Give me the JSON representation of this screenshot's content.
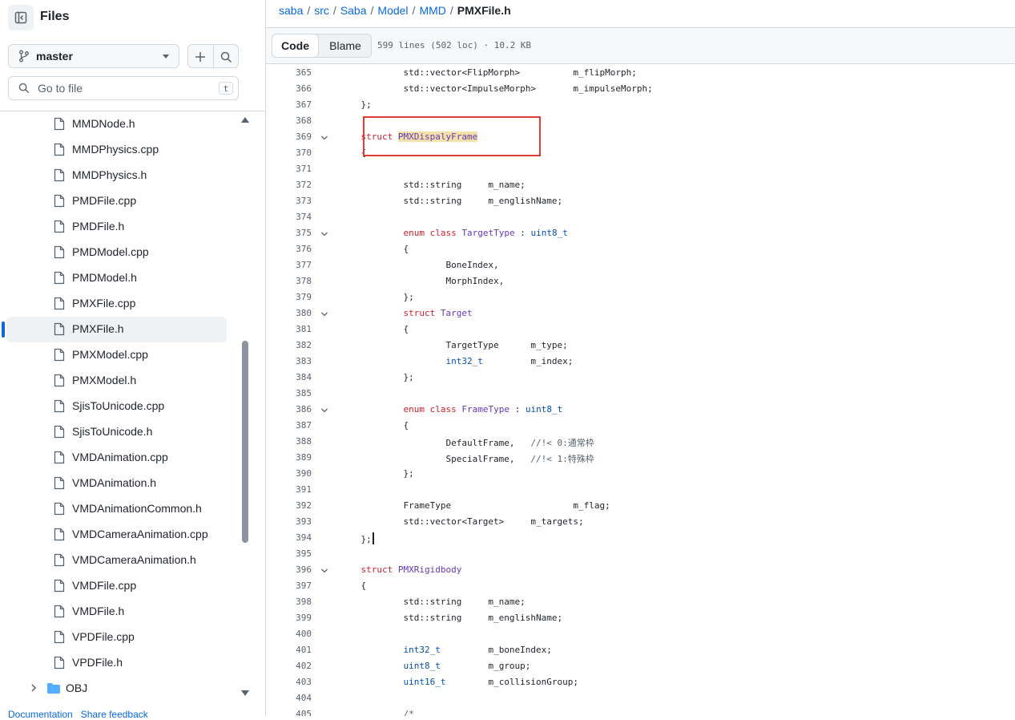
{
  "sidebar": {
    "title": "Files",
    "branch": "master",
    "goto_placeholder": "Go to file",
    "goto_shortcut": "t",
    "files": [
      "MMDNode.h",
      "MMDPhysics.cpp",
      "MMDPhysics.h",
      "PMDFile.cpp",
      "PMDFile.h",
      "PMDModel.cpp",
      "PMDModel.h",
      "PMXFile.cpp",
      "PMXFile.h",
      "PMXModel.cpp",
      "PMXModel.h",
      "SjisToUnicode.cpp",
      "SjisToUnicode.h",
      "VMDAnimation.cpp",
      "VMDAnimation.h",
      "VMDAnimationCommon.h",
      "VMDCameraAnimation.cpp",
      "VMDCameraAnimation.h",
      "VMDFile.cpp",
      "VMDFile.h",
      "VPDFile.cpp",
      "VPDFile.h"
    ],
    "selected_file": "PMXFile.h",
    "folder": "OBJ",
    "footer": [
      "Documentation",
      "Share feedback"
    ]
  },
  "breadcrumb": [
    "saba",
    "src",
    "Saba",
    "Model",
    "MMD"
  ],
  "current_file": "PMXFile.h",
  "toolbar": {
    "code_label": "Code",
    "blame_label": "Blame",
    "file_info": "599 lines (502 loc) · 10.2 KB"
  },
  "code_lines": [
    {
      "n": "365",
      "fold": false,
      "parts": [
        [
          "",
          "            std::vector<FlipMorph>          m_flipMorph;"
        ]
      ]
    },
    {
      "n": "366",
      "fold": false,
      "parts": [
        [
          "",
          "            std::vector<ImpulseMorph>       m_impulseMorph;"
        ]
      ]
    },
    {
      "n": "367",
      "fold": false,
      "parts": [
        [
          "",
          "    };"
        ]
      ]
    },
    {
      "n": "368",
      "fold": false,
      "parts": []
    },
    {
      "n": "369",
      "fold": true,
      "parts": [
        [
          "",
          "    "
        ],
        [
          "kw",
          "struct"
        ],
        [
          "",
          ""
        ],
        [
          "",
          ""
        ],
        [
          "hl ty",
          "PMXDispalyFrame"
        ]
      ],
      "space_after_kw": true
    },
    {
      "n": "370",
      "fold": false,
      "parts": [
        [
          "",
          "    {"
        ]
      ]
    },
    {
      "n": "371",
      "fold": false,
      "parts": []
    },
    {
      "n": "372",
      "fold": false,
      "parts": [
        [
          "",
          "            std::string     m_name;"
        ]
      ]
    },
    {
      "n": "373",
      "fold": false,
      "parts": [
        [
          "",
          "            std::string     m_englishName;"
        ]
      ]
    },
    {
      "n": "374",
      "fold": false,
      "parts": []
    },
    {
      "n": "375",
      "fold": true,
      "parts": [
        [
          "",
          "            "
        ],
        [
          "kw",
          "enum class"
        ],
        [
          "",
          " "
        ],
        [
          "ty",
          "TargetType"
        ],
        [
          "",
          " : "
        ],
        [
          "bt",
          "uint8_t"
        ]
      ]
    },
    {
      "n": "376",
      "fold": false,
      "parts": [
        [
          "",
          "            {"
        ]
      ]
    },
    {
      "n": "377",
      "fold": false,
      "parts": [
        [
          "",
          "                    BoneIndex,"
        ]
      ]
    },
    {
      "n": "378",
      "fold": false,
      "parts": [
        [
          "",
          "                    MorphIndex,"
        ]
      ]
    },
    {
      "n": "379",
      "fold": false,
      "parts": [
        [
          "",
          "            };"
        ]
      ]
    },
    {
      "n": "380",
      "fold": true,
      "parts": [
        [
          "",
          "            "
        ],
        [
          "kw",
          "struct"
        ],
        [
          "",
          " "
        ],
        [
          "ty",
          "Target"
        ]
      ]
    },
    {
      "n": "381",
      "fold": false,
      "parts": [
        [
          "",
          "            {"
        ]
      ]
    },
    {
      "n": "382",
      "fold": false,
      "parts": [
        [
          "",
          "                    TargetType      m_type;"
        ]
      ]
    },
    {
      "n": "383",
      "fold": false,
      "parts": [
        [
          "",
          "                    "
        ],
        [
          "bt",
          "int32_t"
        ],
        [
          "",
          "         m_index;"
        ]
      ]
    },
    {
      "n": "384",
      "fold": false,
      "parts": [
        [
          "",
          "            };"
        ]
      ]
    },
    {
      "n": "385",
      "fold": false,
      "parts": []
    },
    {
      "n": "386",
      "fold": true,
      "parts": [
        [
          "",
          "            "
        ],
        [
          "kw",
          "enum class"
        ],
        [
          "",
          " "
        ],
        [
          "ty",
          "FrameType"
        ],
        [
          "",
          " : "
        ],
        [
          "bt",
          "uint8_t"
        ]
      ]
    },
    {
      "n": "387",
      "fold": false,
      "parts": [
        [
          "",
          "            {"
        ]
      ]
    },
    {
      "n": "388",
      "fold": false,
      "parts": [
        [
          "",
          "                    DefaultFrame,   "
        ],
        [
          "cm",
          "//!< 0:通常枠"
        ]
      ]
    },
    {
      "n": "389",
      "fold": false,
      "parts": [
        [
          "",
          "                    SpecialFrame,   "
        ],
        [
          "cm",
          "//!< 1:特殊枠"
        ]
      ]
    },
    {
      "n": "390",
      "fold": false,
      "parts": [
        [
          "",
          "            };"
        ]
      ]
    },
    {
      "n": "391",
      "fold": false,
      "parts": []
    },
    {
      "n": "392",
      "fold": false,
      "parts": [
        [
          "",
          "            FrameType                       m_flag;"
        ]
      ]
    },
    {
      "n": "393",
      "fold": false,
      "parts": [
        [
          "",
          "            std::vector<Target>     m_targets;"
        ]
      ]
    },
    {
      "n": "394",
      "fold": false,
      "parts": [
        [
          "",
          "    };"
        ]
      ],
      "cursor": true
    },
    {
      "n": "395",
      "fold": false,
      "parts": []
    },
    {
      "n": "396",
      "fold": true,
      "parts": [
        [
          "",
          "    "
        ],
        [
          "kw",
          "struct"
        ],
        [
          "",
          " "
        ],
        [
          "ty",
          "PMXRigidbody"
        ]
      ]
    },
    {
      "n": "397",
      "fold": false,
      "parts": [
        [
          "",
          "    {"
        ]
      ]
    },
    {
      "n": "398",
      "fold": false,
      "parts": [
        [
          "",
          "            std::string     m_name;"
        ]
      ]
    },
    {
      "n": "399",
      "fold": false,
      "parts": [
        [
          "",
          "            std::string     m_englishName;"
        ]
      ]
    },
    {
      "n": "400",
      "fold": false,
      "parts": []
    },
    {
      "n": "401",
      "fold": false,
      "parts": [
        [
          "",
          "            "
        ],
        [
          "bt",
          "int32_t"
        ],
        [
          "",
          "         m_boneIndex;"
        ]
      ]
    },
    {
      "n": "402",
      "fold": false,
      "parts": [
        [
          "",
          "            "
        ],
        [
          "bt",
          "uint8_t"
        ],
        [
          "",
          "         m_group;"
        ]
      ]
    },
    {
      "n": "403",
      "fold": false,
      "parts": [
        [
          "",
          "            "
        ],
        [
          "bt",
          "uint16_t"
        ],
        [
          "",
          "        m_collisionGroup;"
        ]
      ]
    },
    {
      "n": "404",
      "fold": false,
      "parts": []
    },
    {
      "n": "405",
      "fold": false,
      "parts": [
        [
          "",
          "            "
        ],
        [
          "cm",
          "/*"
        ]
      ]
    }
  ]
}
